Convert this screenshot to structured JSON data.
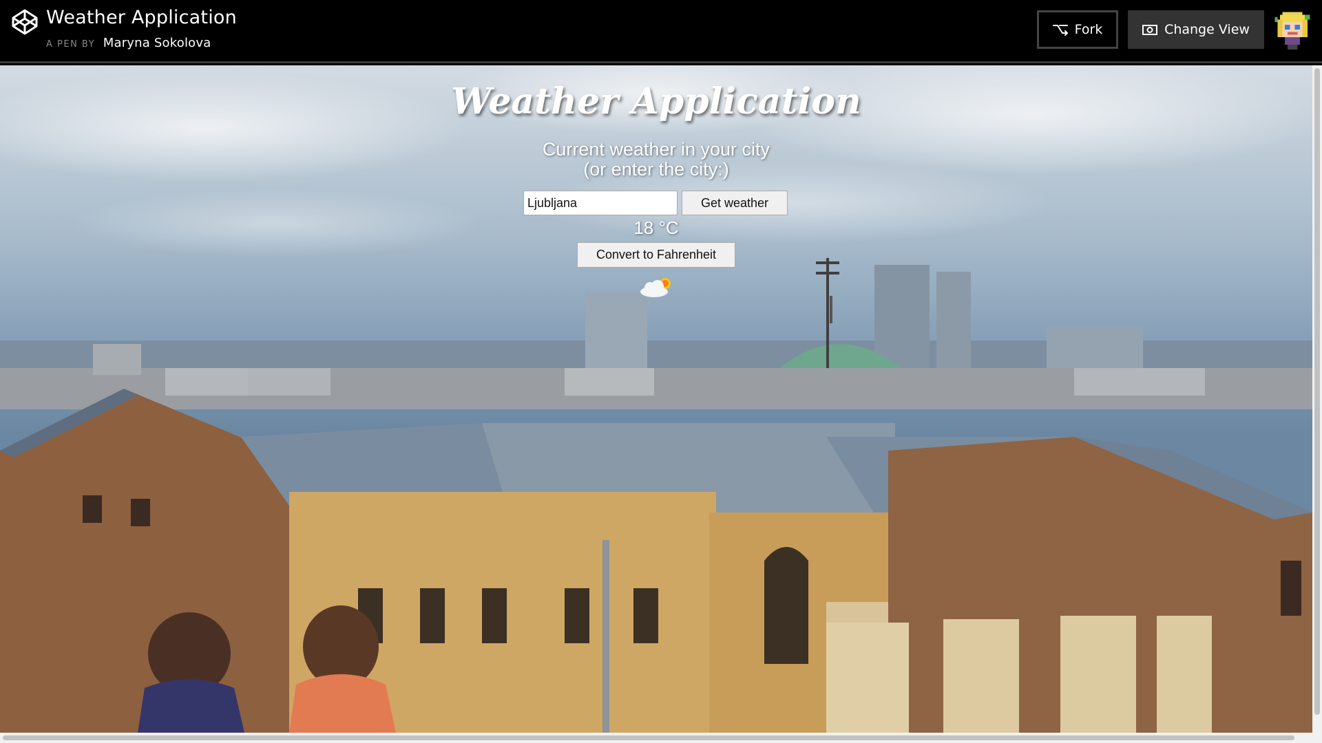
{
  "header": {
    "pen_title": "Weather Application",
    "byline_prefix": "A PEN BY",
    "author": "Maryna Sokolova",
    "fork_label": "Fork",
    "change_view_label": "Change View",
    "logo_icon": "codepen-logo-icon",
    "avatar_icon": "pixel-avatar-icon"
  },
  "app": {
    "title": "Weather Application",
    "subtitle_line1": "Current weather in your city",
    "subtitle_line2": "(or enter the city:)",
    "city_value": "Ljubljana",
    "get_weather_label": "Get weather",
    "temperature": "18 °C",
    "convert_label": "Convert to Fahrenheit",
    "weather_icon": "partly-cloudy-icon"
  },
  "colors": {
    "topbar_bg": "#000000",
    "text_light": "#ffffff",
    "button_gray": "#333333"
  }
}
